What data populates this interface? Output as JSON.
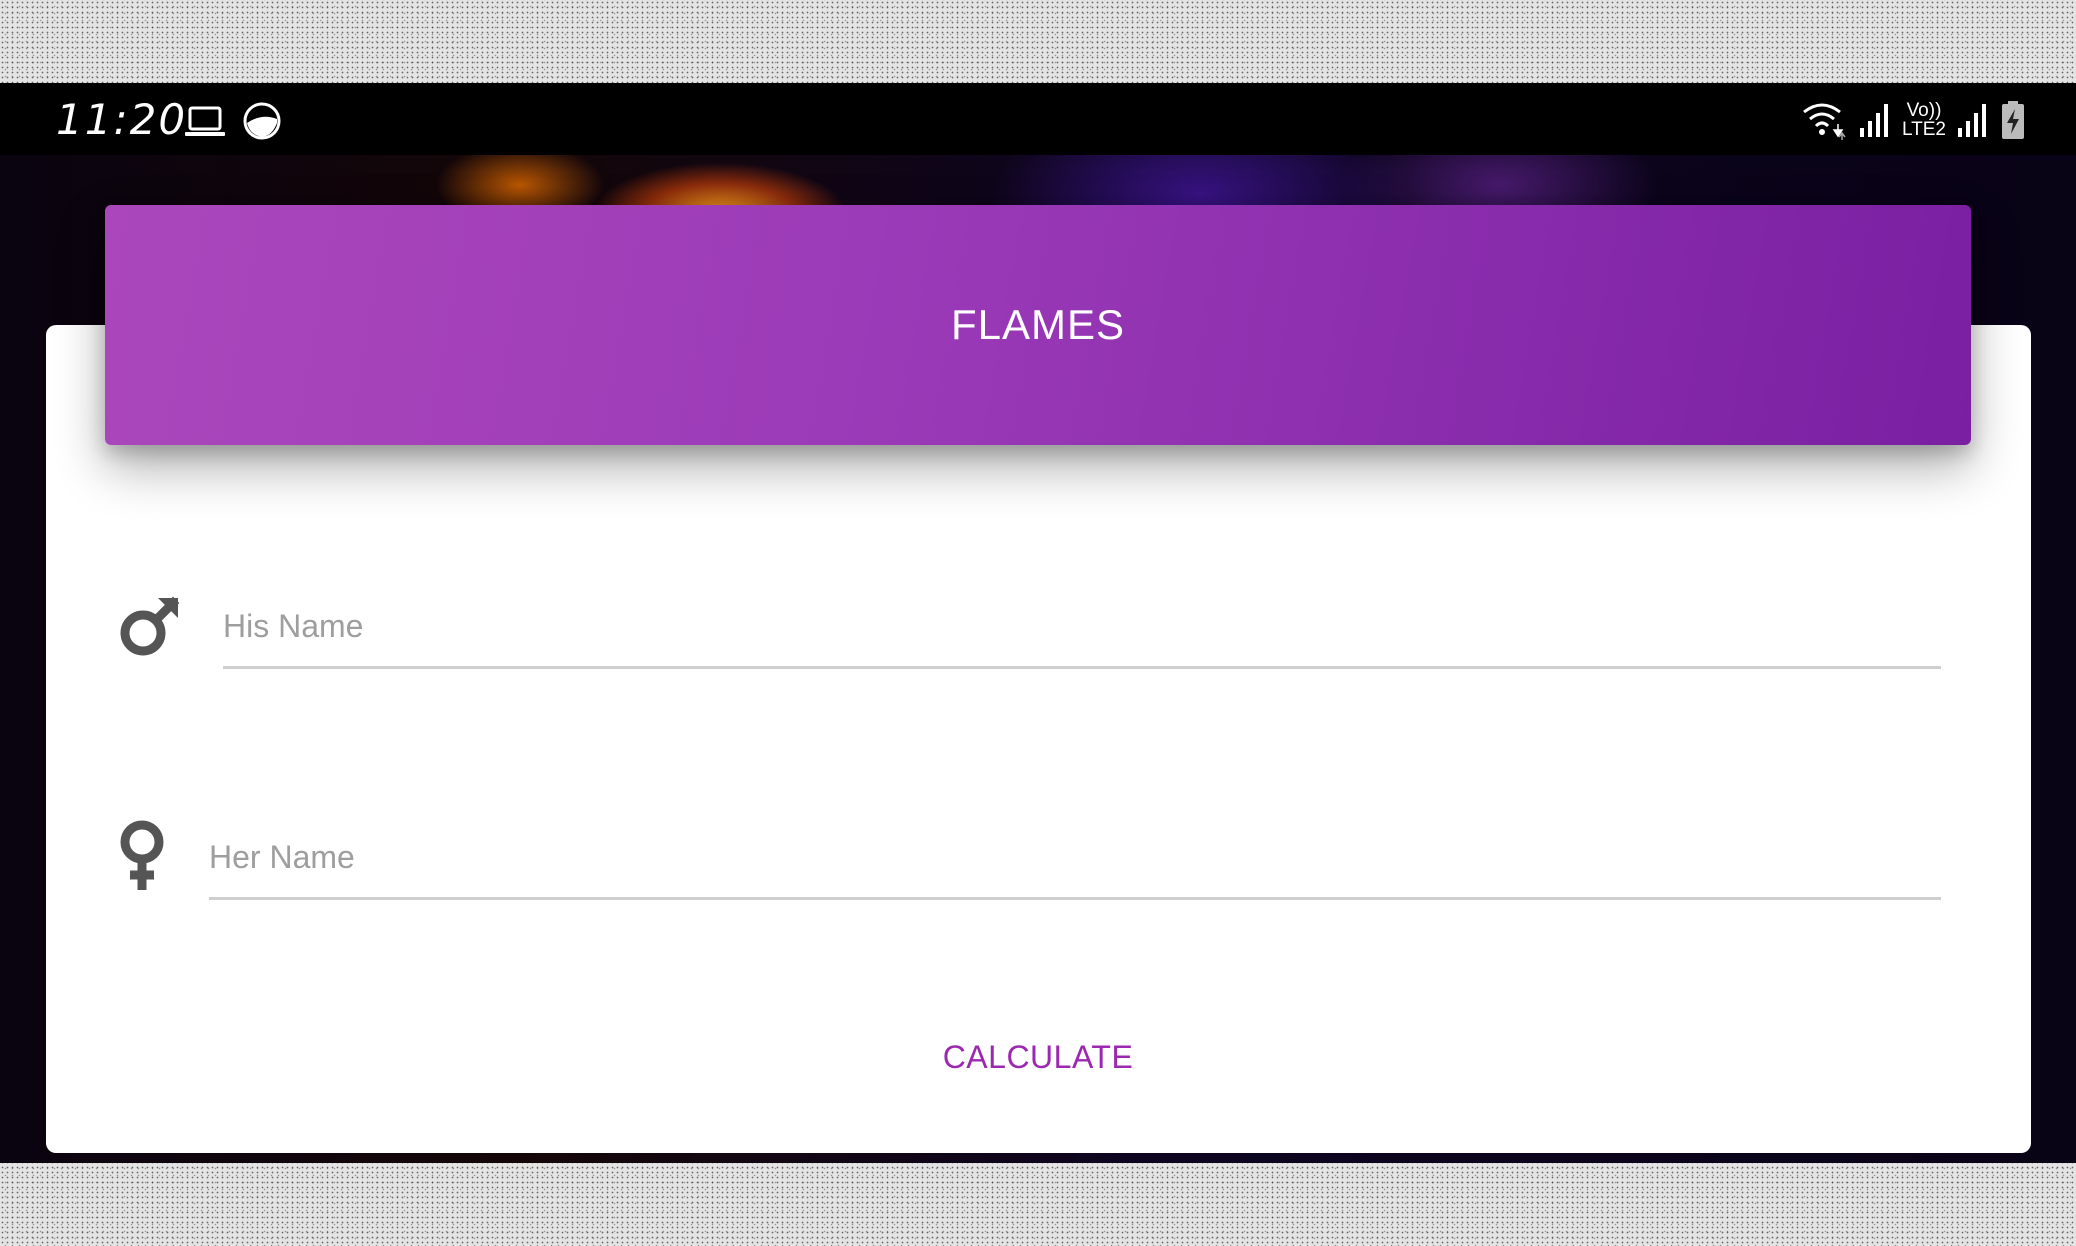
{
  "status_bar": {
    "time": "11:20",
    "network_label_top": "Vo))",
    "network_label_bottom": "LTE2",
    "icons": [
      "laptop-icon",
      "app-icon",
      "wifi-icon",
      "signal-icon",
      "signal-icon",
      "battery-charging-icon"
    ]
  },
  "header": {
    "title": "FLAMES",
    "color_start": "#ab47bc",
    "color_end": "#7b1fa2"
  },
  "form": {
    "his_name": {
      "placeholder": "His Name",
      "value": "",
      "icon": "male-symbol-icon"
    },
    "her_name": {
      "placeholder": "Her Name",
      "value": "",
      "icon": "female-symbol-icon"
    },
    "calculate_label": "CALCULATE",
    "accent_color": "#9c27b0"
  }
}
